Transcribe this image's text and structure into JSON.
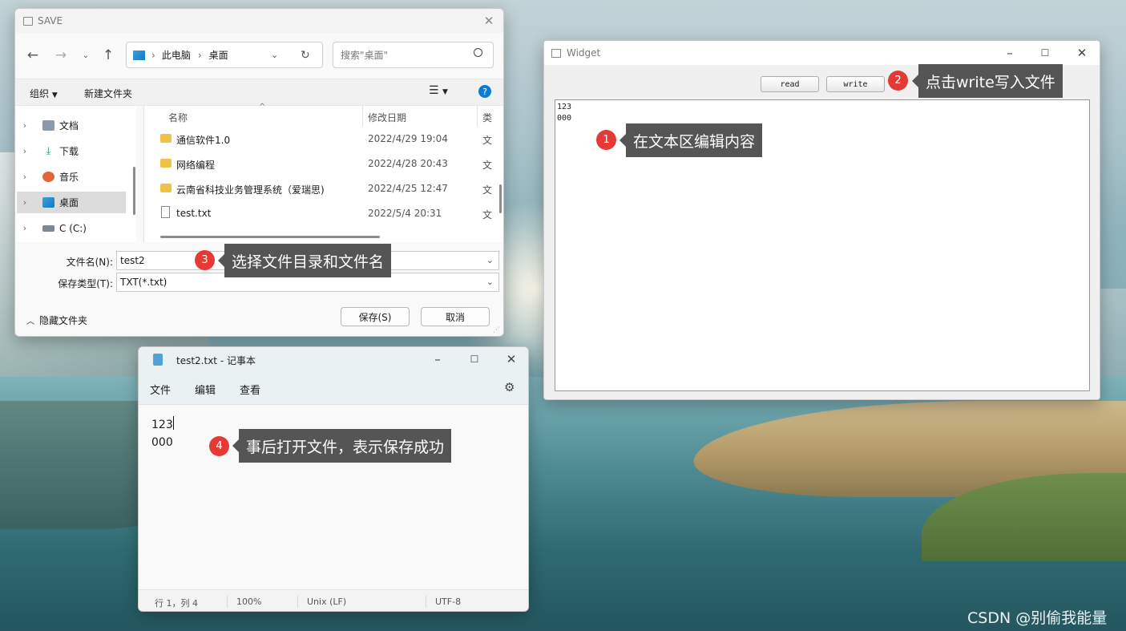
{
  "save_dialog": {
    "title": "SAVE",
    "breadcrumb": [
      "此电脑",
      "桌面"
    ],
    "search_placeholder": "搜索\"桌面\"",
    "toolbar": {
      "organize": "组织",
      "new_folder": "新建文件夹"
    },
    "nav_items": [
      "文档",
      "下载",
      "音乐",
      "桌面",
      "C (C:)"
    ],
    "selected_nav": "桌面",
    "columns": {
      "name": "名称",
      "date": "修改日期",
      "type": "类"
    },
    "files": [
      {
        "name": "通信软件1.0",
        "date": "2022/4/29 19:04",
        "type": "文",
        "kind": "folder"
      },
      {
        "name": "网络编程",
        "date": "2022/4/28 20:43",
        "type": "文",
        "kind": "folder"
      },
      {
        "name": "云南省科技业务管理系统（爱瑞思)",
        "date": "2022/4/25 12:47",
        "type": "文",
        "kind": "folder"
      },
      {
        "name": "test.txt",
        "date": "2022/5/4 20:31",
        "type": "文",
        "kind": "file"
      }
    ],
    "filename_label": "文件名(N):",
    "filename_value": "test2",
    "filetype_label": "保存类型(T):",
    "filetype_value": "TXT(*.txt)",
    "hide_folders": "隐藏文件夹",
    "save_button": "保存(S)",
    "cancel_button": "取消"
  },
  "widget": {
    "title": "Widget",
    "read_button": "read",
    "write_button": "write",
    "text_lines": [
      "123",
      "000"
    ]
  },
  "notepad": {
    "title": "test2.txt - 记事本",
    "menu": [
      "文件",
      "编辑",
      "查看"
    ],
    "text_lines": [
      "123",
      "000"
    ],
    "status": {
      "position": "行 1，列 4",
      "zoom": "100%",
      "line_ending": "Unix (LF)",
      "encoding": "UTF-8"
    }
  },
  "callouts": [
    {
      "number": "1",
      "text": "在文本区编辑内容"
    },
    {
      "number": "2",
      "text": "点击write写入文件"
    },
    {
      "number": "3",
      "text": "选择文件目录和文件名"
    },
    {
      "number": "4",
      "text": "事后打开文件，表示保存成功"
    }
  ],
  "watermark": "CSDN @别偷我能量",
  "colors": {
    "badge": "#e53935",
    "tooltip": "#555555",
    "folder": "#f0c146",
    "accent": "#0a7cd8"
  }
}
